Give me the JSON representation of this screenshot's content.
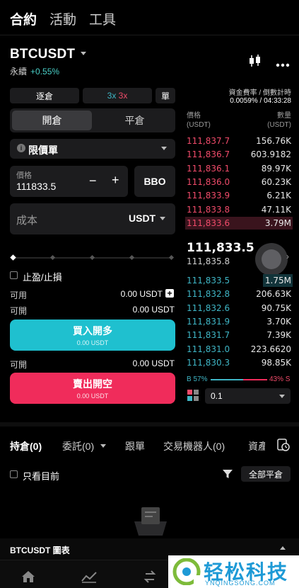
{
  "top_nav": {
    "tabs": [
      "合約",
      "活動",
      "工具"
    ]
  },
  "instrument": {
    "symbol": "BTCUSDT",
    "type": "永續",
    "change": "+0.55%"
  },
  "funding": {
    "label": "資金費率 / 倒數計時",
    "value": "0.0059% / 04:33:28"
  },
  "margin_mode": {
    "cross_label": "逐倉",
    "leverage_a": "3x",
    "leverage_b": "3x",
    "unit_label": "單"
  },
  "order_side": {
    "open": "開倉",
    "close": "平倉"
  },
  "order_type": {
    "icon": "info-icon",
    "value": "限價單"
  },
  "price_field": {
    "label": "價格",
    "value": "111833.5",
    "minus": "−",
    "plus": "+",
    "bbo": "BBO"
  },
  "cost_field": {
    "label": "成本",
    "unit": "USDT"
  },
  "slider": {
    "level": 0
  },
  "tpsl": {
    "label": "止盈/止損"
  },
  "available": {
    "label": "可用",
    "value": "0.00 USDT"
  },
  "can_open_buy": {
    "label": "可開",
    "value": "0.00 USDT"
  },
  "can_open_sell": {
    "label": "可開",
    "value": "0.00 USDT"
  },
  "buy_button": {
    "label": "買入開多",
    "sub": "0.00 USDT"
  },
  "sell_button": {
    "label": "賣出開空",
    "sub": "0.00 USDT"
  },
  "orderbook": {
    "price_header": "價格\n(USDT)",
    "qty_header": "數量\n(USDT)",
    "price_header_l1": "價格",
    "price_header_l2": "(USDT)",
    "qty_header_l1": "數量",
    "qty_header_l2": "(USDT)",
    "asks": [
      {
        "price": "111,837.7",
        "qty": "156.76K"
      },
      {
        "price": "111,836.7",
        "qty": "603.9182"
      },
      {
        "price": "111,836.1",
        "qty": "89.97K"
      },
      {
        "price": "111,836.0",
        "qty": "60.23K"
      },
      {
        "price": "111,833.9",
        "qty": "6.21K"
      },
      {
        "price": "111,833.8",
        "qty": "47.11K"
      },
      {
        "price": "111,833.6",
        "qty": "3.79M"
      }
    ],
    "last_price": "111,833.5",
    "mark_price": "111,835.8",
    "bids": [
      {
        "price": "111,833.5",
        "qty": "1.75M"
      },
      {
        "price": "111,832.8",
        "qty": "206.63K"
      },
      {
        "price": "111,832.6",
        "qty": "90.75K"
      },
      {
        "price": "111,831.9",
        "qty": "3.70K"
      },
      {
        "price": "111,831.7",
        "qty": "7.39K"
      },
      {
        "price": "111,831.0",
        "qty": "223.6620"
      },
      {
        "price": "111,830.3",
        "qty": "98.85K"
      }
    ],
    "buy_ratio": "B 57%",
    "sell_ratio": "43% S",
    "buy_fraction": 0.57,
    "precision": "0.1"
  },
  "position_tabs": [
    "持倉(0)",
    "委託(0)",
    "跟單",
    "交易機器人(0)",
    "資產"
  ],
  "filters": {
    "only_current": "只看目前",
    "close_all": "全部平倉"
  },
  "chart_bar": {
    "label": "BTCUSDT 圖表"
  },
  "watermark": {
    "brand": "轻松科技",
    "site": "YNQINGSONG.COM"
  },
  "colors": {
    "buy": "#1fc0cf",
    "sell": "#f02c5b",
    "ask_text": "#f04b6a",
    "bid_text": "#3fb6c6",
    "accent_green": "#4ad0c8"
  }
}
